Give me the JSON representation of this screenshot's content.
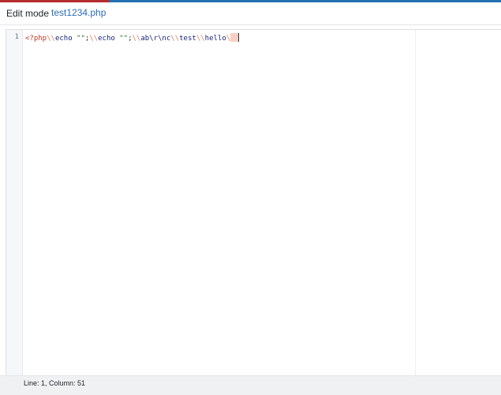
{
  "header": {
    "mode_label": "Edit mode",
    "file_tab": "test1234.php"
  },
  "editor": {
    "line_numbers": [
      "1"
    ],
    "code_line_1": [
      {
        "text": "<?php",
        "color": "#c0392b"
      },
      {
        "text": "\\\\",
        "color": "#e07b53"
      },
      {
        "text": "echo ",
        "color": "#1a237e"
      },
      {
        "text": "\"\"",
        "color": "#2e7d32"
      },
      {
        "text": ";",
        "color": "#1d2327"
      },
      {
        "text": "\\\\",
        "color": "#e07b53"
      },
      {
        "text": "echo ",
        "color": "#1a237e"
      },
      {
        "text": "\"\"",
        "color": "#2e7d32"
      },
      {
        "text": ";",
        "color": "#1d2327"
      },
      {
        "text": "\\\\",
        "color": "#e07b53"
      },
      {
        "text": "ab\\r\\nc",
        "color": "#1a237e"
      },
      {
        "text": "\\\\",
        "color": "#e07b53"
      },
      {
        "text": "test",
        "color": "#1a237e"
      },
      {
        "text": "\\\\",
        "color": "#e07b53"
      },
      {
        "text": "hello",
        "color": "#1a237e"
      },
      {
        "text": "\\",
        "color": "#e07b53"
      }
    ]
  },
  "status": {
    "position_text": "Line: 1, Column: 51"
  },
  "colors": {
    "accent_left": "#b32d2e",
    "accent_right": "#2271b1"
  }
}
